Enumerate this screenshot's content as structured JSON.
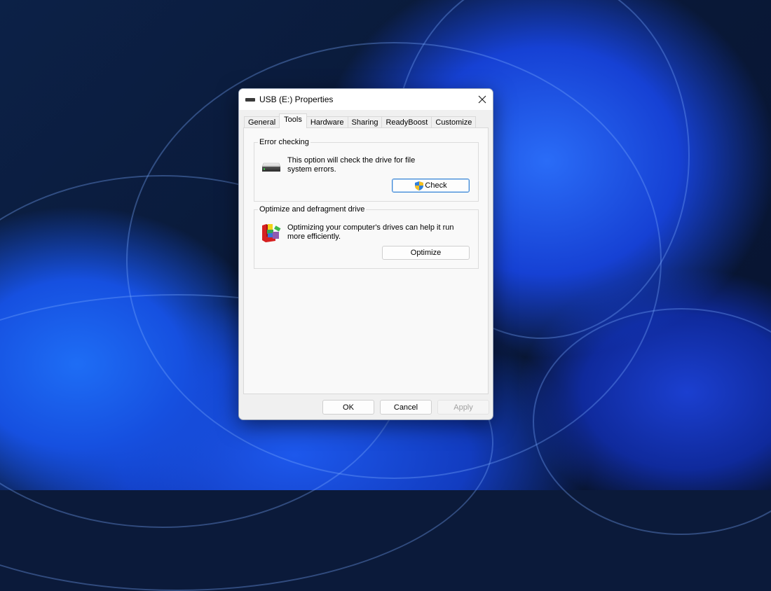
{
  "window": {
    "title": "USB (E:) Properties",
    "title_icon": "drive-icon",
    "close_icon": "close-icon"
  },
  "tabs": [
    {
      "label": "General",
      "active": false
    },
    {
      "label": "Tools",
      "active": true
    },
    {
      "label": "Hardware",
      "active": false
    },
    {
      "label": "Sharing",
      "active": false
    },
    {
      "label": "ReadyBoost",
      "active": false
    },
    {
      "label": "Customize",
      "active": false
    }
  ],
  "error_checking": {
    "heading": "Error checking",
    "icon": "hard-drive-icon",
    "description_line1": "This option will check the drive for file",
    "description_line2": "system errors.",
    "button_label": "Check",
    "button_icon": "uac-shield-icon"
  },
  "optimize": {
    "heading": "Optimize and defragment drive",
    "icon": "defragment-icon",
    "description_line1": "Optimizing your computer's drives can help it run",
    "description_line2": "more efficiently.",
    "button_label": "Optimize"
  },
  "footer": {
    "ok_label": "OK",
    "cancel_label": "Cancel",
    "apply_label": "Apply",
    "apply_enabled": false
  }
}
